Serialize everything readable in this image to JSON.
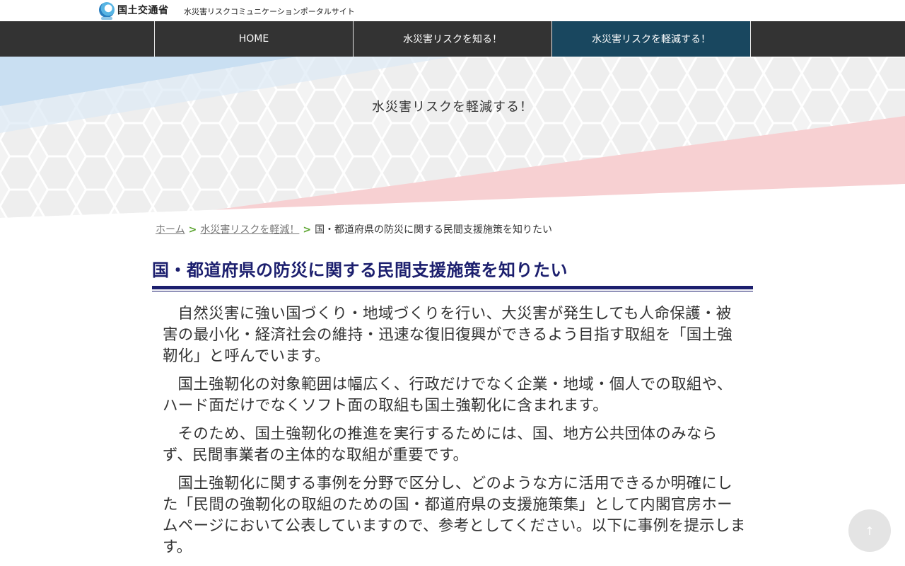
{
  "header": {
    "logo_text": "国土交通省",
    "site_name": "水災害リスクコミュニケーションポータルサイト"
  },
  "nav": {
    "items": [
      {
        "label": "HOME"
      },
      {
        "label": "水災害リスクを知る！"
      },
      {
        "label": "水災害リスクを軽減する！"
      }
    ],
    "active_index": 2
  },
  "hero": {
    "title": "水災害リスクを軽減する！",
    "colors": {
      "blue_band": "#c9dff2",
      "red_band": "#f7d0d2",
      "pattern": "#e9e9e9"
    }
  },
  "breadcrumb": {
    "home": "ホーム",
    "sep1": ">",
    "parent": "水災害リスクを軽減！",
    "sep2": ">",
    "current": "国・都道府県の防災に関する民間支援施策を知りたい"
  },
  "page": {
    "title": "国・都道府県の防災に関する民間支援施策を知りたい",
    "title_color": "#1c1f6e",
    "paragraphs": [
      "自然災害に強い国づくり・地域づくりを行い、大災害が発生しても人命保護・被害の最小化・経済社会の維持・迅速な復旧復興ができるよう目指す取組を「国土強靭化」と呼んでいます。",
      "国土強靭化の対象範囲は幅広く、行政だけでなく企業・地域・個人での取組や、ハード面だけでなくソフト面の取組も国土強靭化に含まれます。",
      "そのため、国土強靭化の推進を実行するためには、国、地方公共団体のみならず、民間事業者の主体的な取組が重要です。",
      "国土強靭化に関する事例を分野で区分し、どのような方に活用できるか明確にした「民間の強靭化の取組のための国・都道府県の支援施策集」として内閣官房ホームページにおいて公表していますので、参考としてください。以下に事例を提示します。"
    ]
  },
  "to_top": {
    "icon": "arrow-up-icon",
    "glyph": "↑"
  }
}
